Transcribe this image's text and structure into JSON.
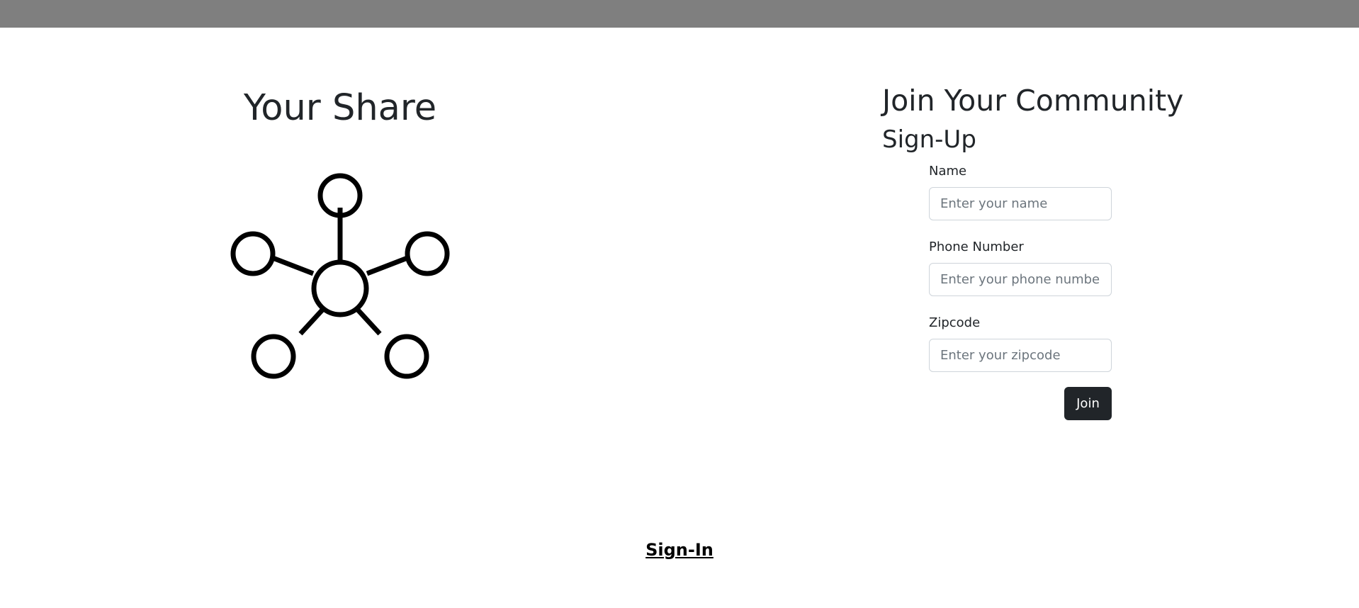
{
  "brand": {
    "title": "Your Share",
    "icon": "network-hub-icon"
  },
  "signup": {
    "heading": "Join Your Community",
    "subheading": "Sign-Up",
    "fields": {
      "name": {
        "label": "Name",
        "placeholder": "Enter your name",
        "value": ""
      },
      "phone": {
        "label": "Phone Number",
        "placeholder": "Enter your phone number",
        "value": ""
      },
      "zipcode": {
        "label": "Zipcode",
        "placeholder": "Enter your zipcode",
        "value": ""
      }
    },
    "submit_label": "Join"
  },
  "footer": {
    "signin_label": "Sign-In"
  },
  "colors": {
    "topbar": "#7f7f7f",
    "button_bg": "#212529",
    "text": "#212529"
  }
}
